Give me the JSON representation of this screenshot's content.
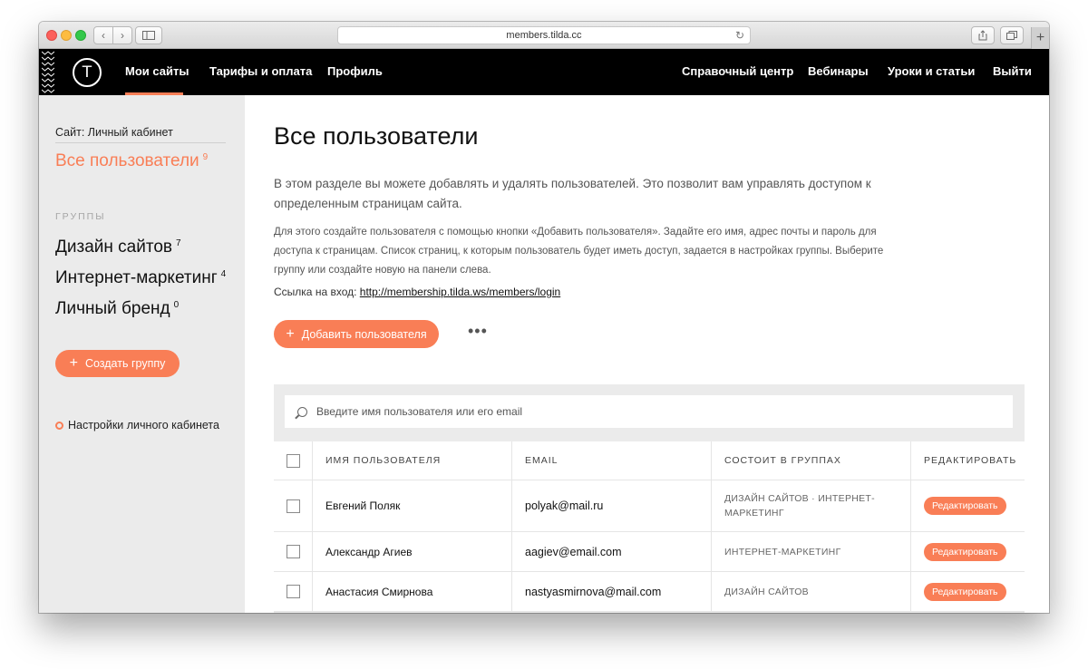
{
  "browser": {
    "url": "members.tilda.cc"
  },
  "topnav": {
    "left_items": [
      "Мои сайты",
      "Тарифы и оплата",
      "Профиль"
    ],
    "right_items": [
      "Справочный центр",
      "Вебинары",
      "Уроки и статьи",
      "Выйти"
    ],
    "logo_letter": "T"
  },
  "sidebar": {
    "site_label": "Сайт: Личный кабинет",
    "all_users": {
      "label": "Все пользователи",
      "count": "9"
    },
    "groups_title": "ГРУППЫ",
    "groups": [
      {
        "label": "Дизайн сайтов",
        "count": "7"
      },
      {
        "label": "Интернет-маркетинг",
        "count": "4"
      },
      {
        "label": "Личный бренд",
        "count": "0"
      }
    ],
    "create_group_label": "Создать группу",
    "settings_label": "Настройки личного кабинета"
  },
  "main": {
    "title": "Все пользователи",
    "description": "В этом разделе вы можете добавлять и удалять пользователей. Это позволит вам управлять доступом к определенным страницам сайта.",
    "instructions": "Для этого создайте пользователя с помощью кнопки «Добавить пользователя». Задайте его имя, адрес почты и пароль для доступа к страницам. Список страниц, к которым пользователь будет иметь доступ, задается в настройках группы. Выберите группу или создайте новую на панели слева.",
    "login_label": "Ссылка на вход:",
    "login_url": "http://membership.tilda.ws/members/login",
    "add_user_label": "Добавить пользователя",
    "more_label": "•••",
    "search_placeholder": "Введите имя пользователя или его email"
  },
  "table": {
    "headers": [
      "ИМЯ ПОЛЬЗОВАТЕЛЯ",
      "EMAIL",
      "СОСТОИТ В ГРУППАХ",
      "РЕДАКТИРОВАТЬ"
    ],
    "rows": [
      {
        "name": "Евгений Поляк",
        "email": "polyak@mail.ru",
        "groups": "ДИЗАЙН САЙТОВ · ИНТЕРНЕТ-МАРКЕТИНГ",
        "edit": "Редактировать"
      },
      {
        "name": "Александр Агиев",
        "email": "aagiev@email.com",
        "groups": "ИНТЕРНЕТ-МАРКЕТИНГ",
        "edit": "Редактировать"
      },
      {
        "name": "Анастасия Смирнова",
        "email": "nastyasmirnova@mail.com",
        "groups": "ДИЗАЙН САЙТОВ",
        "edit": "Редактировать"
      }
    ]
  },
  "colors": {
    "accent": "#f97e56",
    "nav_bg": "#000000",
    "sidebar_bg": "#ebebeb"
  }
}
